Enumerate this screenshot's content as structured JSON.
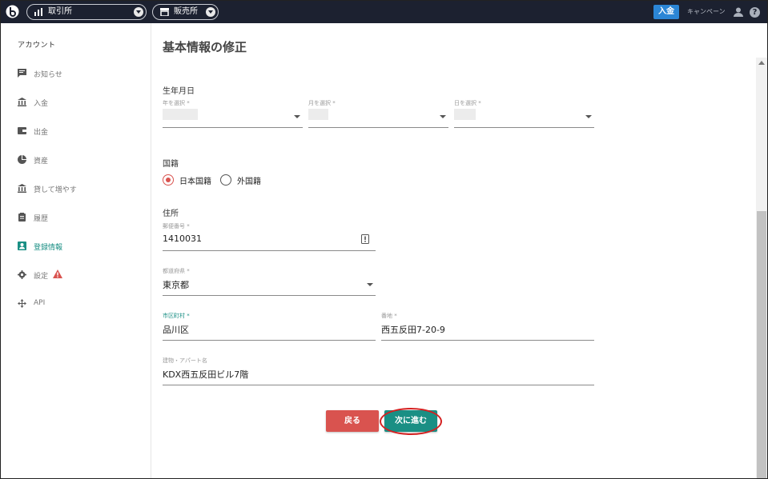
{
  "header": {
    "exchange_label": "取引所",
    "shop_label": "販売所",
    "deposit_button": "入金",
    "campaign_link": "キャンペーン",
    "help_label": "?"
  },
  "sidebar": {
    "title": "アカウント",
    "items": [
      {
        "label": "お知らせ",
        "icon": "announcement-icon"
      },
      {
        "label": "入金",
        "icon": "bank-icon"
      },
      {
        "label": "出金",
        "icon": "wallet-icon"
      },
      {
        "label": "資産",
        "icon": "pie-chart-icon"
      },
      {
        "label": "貸して増やす",
        "icon": "bank-icon"
      },
      {
        "label": "履歴",
        "icon": "clipboard-icon"
      },
      {
        "label": "登録情報",
        "icon": "contact-card-icon",
        "active": true
      },
      {
        "label": "設定",
        "icon": "gear-icon"
      },
      {
        "label": "API",
        "icon": "move-arrows-icon"
      }
    ]
  },
  "main": {
    "title": "基本情報の修正",
    "birth": {
      "label": "生年月日",
      "year_hint": "年を選択 *",
      "month_hint": "月を選択 *",
      "day_hint": "日を選択 *"
    },
    "nationality": {
      "label": "国籍",
      "options": [
        "日本国籍",
        "外国籍"
      ],
      "selected": "日本国籍"
    },
    "address": {
      "label": "住所",
      "postal_hint": "郵便番号 *",
      "postal_value": "1410031",
      "prefecture_hint": "都道府県 *",
      "prefecture_value": "東京都",
      "city_hint": "市区町村 *",
      "city_value": "品川区",
      "street_hint": "番地 *",
      "street_value": "西五反田7-20-9",
      "building_hint": "建物・アパート名",
      "building_value": "KDX西五反田ビル7階"
    },
    "back_button": "戻る",
    "next_button": "次に進む"
  },
  "colors": {
    "header_bg": "#1c2130",
    "accent": "#1a8f84",
    "danger": "#d9534f",
    "deposit": "#2b86d6"
  }
}
